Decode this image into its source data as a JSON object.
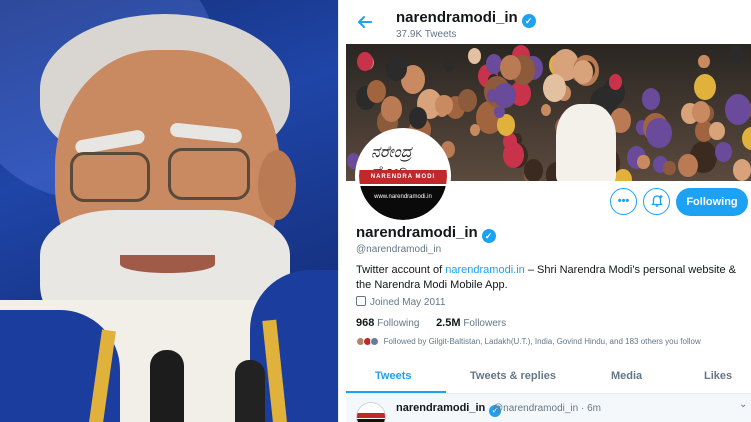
{
  "header": {
    "name": "narendramodi_in",
    "tweet_count": "37.9K Tweets",
    "back_icon": "arrow-left-icon"
  },
  "profile": {
    "name": "narendramodi_in",
    "handle": "@narendramodi_in",
    "bio_prefix": "Twitter account of ",
    "bio_link": "narendramodi.in",
    "bio_suffix": " – Shri Narendra Modi's personal website & the Narendra Modi Mobile App.",
    "joined": "Joined May 2011",
    "following_count": "968",
    "following_label": "Following",
    "followers_count": "2.5M",
    "followers_label": "Followers",
    "followed_by": "Followed by Gilgit-Baltistan, Ladakh(U.T.), India, Govind Hindu, and 183 others you follow",
    "avatar": {
      "signature": "ನರೇಂದ್ರ ಮೋದಿ",
      "brand": "NARENDRA MODI",
      "site": "www.narendramodi.in"
    }
  },
  "actions": {
    "more_icon": "ellipsis-icon",
    "more_glyph": "•••",
    "notify_icon": "bell-plus-icon",
    "notify_glyph": "🔔",
    "follow_label": "Following"
  },
  "tabs": [
    {
      "label": "Tweets",
      "active": true
    },
    {
      "label": "Tweets & replies",
      "active": false
    },
    {
      "label": "Media",
      "active": false
    },
    {
      "label": "Likes",
      "active": false
    }
  ],
  "tweet": {
    "name": "narendramodi_in",
    "handle_time": "@narendramodi_in · 6m",
    "caret": "⌄"
  },
  "colors": {
    "accent": "#1da1f2",
    "text": "#14171a",
    "muted": "#657786"
  }
}
